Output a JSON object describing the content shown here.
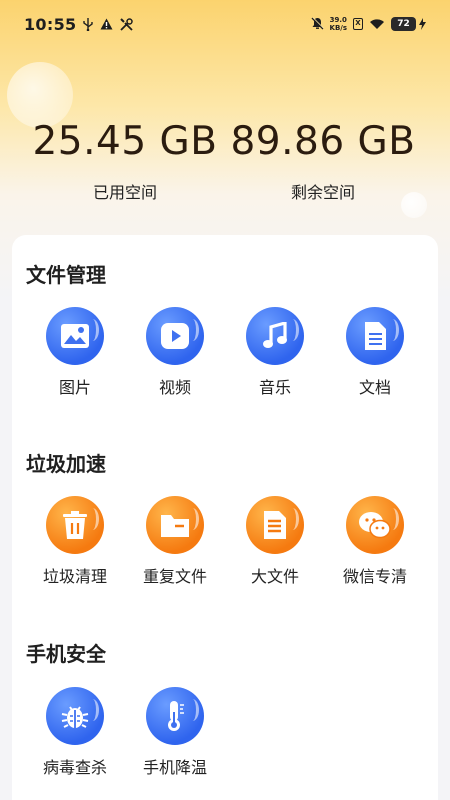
{
  "status_bar": {
    "time": "10:55",
    "net_speed_value": "39.0",
    "net_speed_unit": "KB/s",
    "sim_label": "X",
    "battery": "72",
    "left_icons": [
      "usb-icon",
      "warning-icon",
      "tools-icon"
    ],
    "right_icons": [
      "mute-icon",
      "wifi-icon",
      "charging-icon"
    ]
  },
  "storage": {
    "used_value": "25.45 GB",
    "used_label": "已用空间",
    "free_value": "89.86 GB",
    "free_label": "剩余空间"
  },
  "sections": [
    {
      "title": "文件管理",
      "items": [
        {
          "label": "图片",
          "icon": "image-icon",
          "color": "blue"
        },
        {
          "label": "视频",
          "icon": "video-icon",
          "color": "blue"
        },
        {
          "label": "音乐",
          "icon": "music-icon",
          "color": "blue"
        },
        {
          "label": "文档",
          "icon": "document-icon",
          "color": "blue"
        }
      ]
    },
    {
      "title": "垃圾加速",
      "items": [
        {
          "label": "垃圾清理",
          "icon": "trash-icon",
          "color": "orange"
        },
        {
          "label": "重复文件",
          "icon": "folder-icon",
          "color": "orange"
        },
        {
          "label": "大文件",
          "icon": "large-file-icon",
          "color": "orange"
        },
        {
          "label": "微信专清",
          "icon": "wechat-icon",
          "color": "orange"
        }
      ]
    },
    {
      "title": "手机安全",
      "items": [
        {
          "label": "病毒查杀",
          "icon": "virus-icon",
          "color": "blue"
        },
        {
          "label": "手机降温",
          "icon": "thermometer-icon",
          "color": "blue"
        }
      ]
    }
  ],
  "colors": {
    "blue": "#2f64ee",
    "orange": "#f57a10",
    "header_yellow": "#fbd36e",
    "value_text": "#2b1c0f"
  }
}
